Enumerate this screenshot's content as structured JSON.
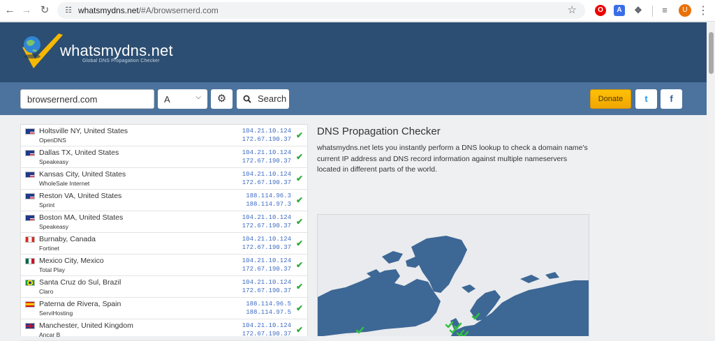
{
  "browser": {
    "url_domain": "whatsmydns.net",
    "url_path": "/#A/browsernerd.com",
    "avatar_letter": "U"
  },
  "header": {
    "brand": "whatsmydns.net",
    "tagline": "Global DNS Propagation Checker"
  },
  "search": {
    "domain_value": "browsernerd.com",
    "record_type": "A",
    "search_label": "Search",
    "donate_label": "Donate",
    "twitter_glyph": "t",
    "facebook_glyph": "f"
  },
  "results": [
    {
      "location": "Holtsville NY, United States",
      "provider": "OpenDNS",
      "ip1": "104.21.10.124",
      "ip2": "172.67.190.37",
      "flag": "us"
    },
    {
      "location": "Dallas TX, United States",
      "provider": "Speakeasy",
      "ip1": "104.21.10.124",
      "ip2": "172.67.190.37",
      "flag": "us"
    },
    {
      "location": "Kansas City, United States",
      "provider": "WholeSale Internet",
      "ip1": "104.21.10.124",
      "ip2": "172.67.190.37",
      "flag": "us"
    },
    {
      "location": "Reston VA, United States",
      "provider": "Sprint",
      "ip1": "188.114.96.3",
      "ip2": "188.114.97.3",
      "flag": "us"
    },
    {
      "location": "Boston MA, United States",
      "provider": "Speakeasy",
      "ip1": "104.21.10.124",
      "ip2": "172.67.190.37",
      "flag": "us"
    },
    {
      "location": "Burnaby, Canada",
      "provider": "Fortinet",
      "ip1": "104.21.10.124",
      "ip2": "172.67.190.37",
      "flag": "ca"
    },
    {
      "location": "Mexico City, Mexico",
      "provider": "Total Play",
      "ip1": "104.21.10.124",
      "ip2": "172.67.190.37",
      "flag": "mx"
    },
    {
      "location": "Santa Cruz do Sul, Brazil",
      "provider": "Claro",
      "ip1": "104.21.10.124",
      "ip2": "172.67.190.37",
      "flag": "br"
    },
    {
      "location": "Paterna de Rivera, Spain",
      "provider": "ServiHosting",
      "ip1": "188.114.96.5",
      "ip2": "188.114.97.5",
      "flag": "es"
    },
    {
      "location": "Manchester, United Kingdom",
      "provider": "Ancar B",
      "ip1": "104.21.10.124",
      "ip2": "172.67.190.37",
      "flag": "gb"
    }
  ],
  "info": {
    "title": "DNS Propagation Checker",
    "description": "whatsmydns.net lets you instantly perform a DNS lookup to check a domain name's current IP address and DNS record information against multiple nameservers located in different parts of the world."
  },
  "colors": {
    "header_bg": "#2c4e72",
    "band_bg": "#4b739d",
    "ip_blue": "#3d6bc2",
    "check_green": "#2eaa3a",
    "donate_yellow": "#ffc107",
    "map_land": "#3d6795"
  },
  "icons": {
    "back": "arrow-left-icon",
    "forward": "arrow-right-icon",
    "reload": "reload-icon",
    "settings": "gear-icon",
    "search": "magnifier-icon",
    "status": "checkmark-icon"
  }
}
